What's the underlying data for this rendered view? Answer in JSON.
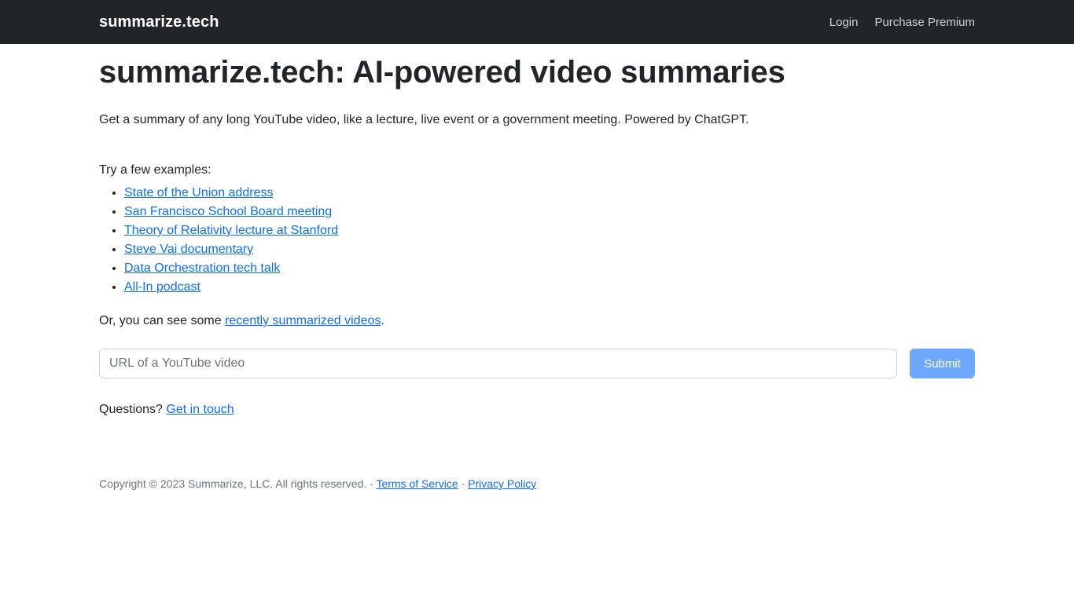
{
  "navbar": {
    "brand": "summarize.tech",
    "links": [
      {
        "label": "Login"
      },
      {
        "label": "Purchase Premium"
      }
    ]
  },
  "main": {
    "title": "summarize.tech: AI-powered video summaries",
    "lead": "Get a summary of any long YouTube video, like a lecture, live event or a government meeting. Powered by ChatGPT.",
    "examples_intro": "Try a few examples:",
    "examples": [
      {
        "label": "State of the Union address"
      },
      {
        "label": "San Francisco School Board meeting"
      },
      {
        "label": "Theory of Relativity lecture at Stanford"
      },
      {
        "label": "Steve Vai documentary"
      },
      {
        "label": "Data Orchestration tech talk"
      },
      {
        "label": "All-In podcast"
      }
    ],
    "recent": {
      "prefix": "Or, you can see some ",
      "link": "recently summarized videos",
      "suffix": "."
    },
    "form": {
      "placeholder": "URL of a YouTube video",
      "value": "",
      "submit_label": "Submit"
    },
    "questions": {
      "prefix": "Questions? ",
      "link": "Get in touch"
    }
  },
  "footer": {
    "copyright": "Copyright © 2023 Summarize, LLC. All rights reserved. ·",
    "separator": "·",
    "links": [
      {
        "label": "Terms of Service"
      },
      {
        "label": "Privacy Policy"
      }
    ]
  },
  "colors": {
    "navbar_bg": "#212529",
    "link": "#0d6efd",
    "submit_bg": "#6ea8fe",
    "text": "#212529",
    "muted": "#6c757d"
  }
}
